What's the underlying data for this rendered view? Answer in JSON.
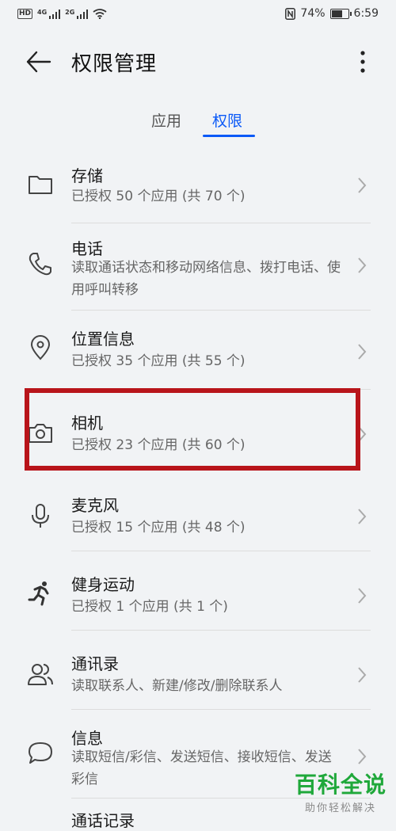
{
  "status_bar": {
    "hd_label": "HD",
    "net_1": "4G",
    "net_2": "2G",
    "battery_percent": "74%",
    "battery_level": 0.74,
    "time": "6:59",
    "icons": [
      "hd-icon",
      "signal-icon",
      "wifi-icon",
      "nfc-icon",
      "battery-icon"
    ]
  },
  "header": {
    "title": "权限管理",
    "back_icon": "arrow-left-icon",
    "more_icon": "more-vertical-icon"
  },
  "tabs": [
    {
      "label": "应用",
      "active": false
    },
    {
      "label": "权限",
      "active": true
    }
  ],
  "colors": {
    "accent": "#0a59f7",
    "highlight": "#b8141a",
    "background": "#f1f3f5",
    "watermark": "#1fa83a"
  },
  "permissions": [
    {
      "title": "存储",
      "subtitle": "已授权 50 个应用 (共 70 个)",
      "icon": "folder-icon"
    },
    {
      "title": "电话",
      "subtitle": "读取通话状态和移动网络信息、拨打电话、使用呼叫转移",
      "icon": "phone-icon"
    },
    {
      "title": "位置信息",
      "subtitle": "已授权 35 个应用 (共 55 个)",
      "icon": "location-icon"
    },
    {
      "title": "相机",
      "subtitle": "已授权 23 个应用 (共 60 个)",
      "icon": "camera-icon",
      "highlighted": true
    },
    {
      "title": "麦克风",
      "subtitle": "已授权 15 个应用 (共 48 个)",
      "icon": "microphone-icon"
    },
    {
      "title": "健身运动",
      "subtitle": "已授权 1 个应用 (共 1 个)",
      "icon": "running-icon"
    },
    {
      "title": "通讯录",
      "subtitle": "读取联系人、新建/修改/删除联系人",
      "icon": "contacts-icon"
    },
    {
      "title": "信息",
      "subtitle": "读取短信/彩信、发送短信、接收短信、发送彩信",
      "icon": "message-icon"
    },
    {
      "title": "通话记录",
      "subtitle": "",
      "icon": ""
    }
  ],
  "watermark": {
    "main": "百科全说",
    "sub": "助你轻松解决"
  }
}
